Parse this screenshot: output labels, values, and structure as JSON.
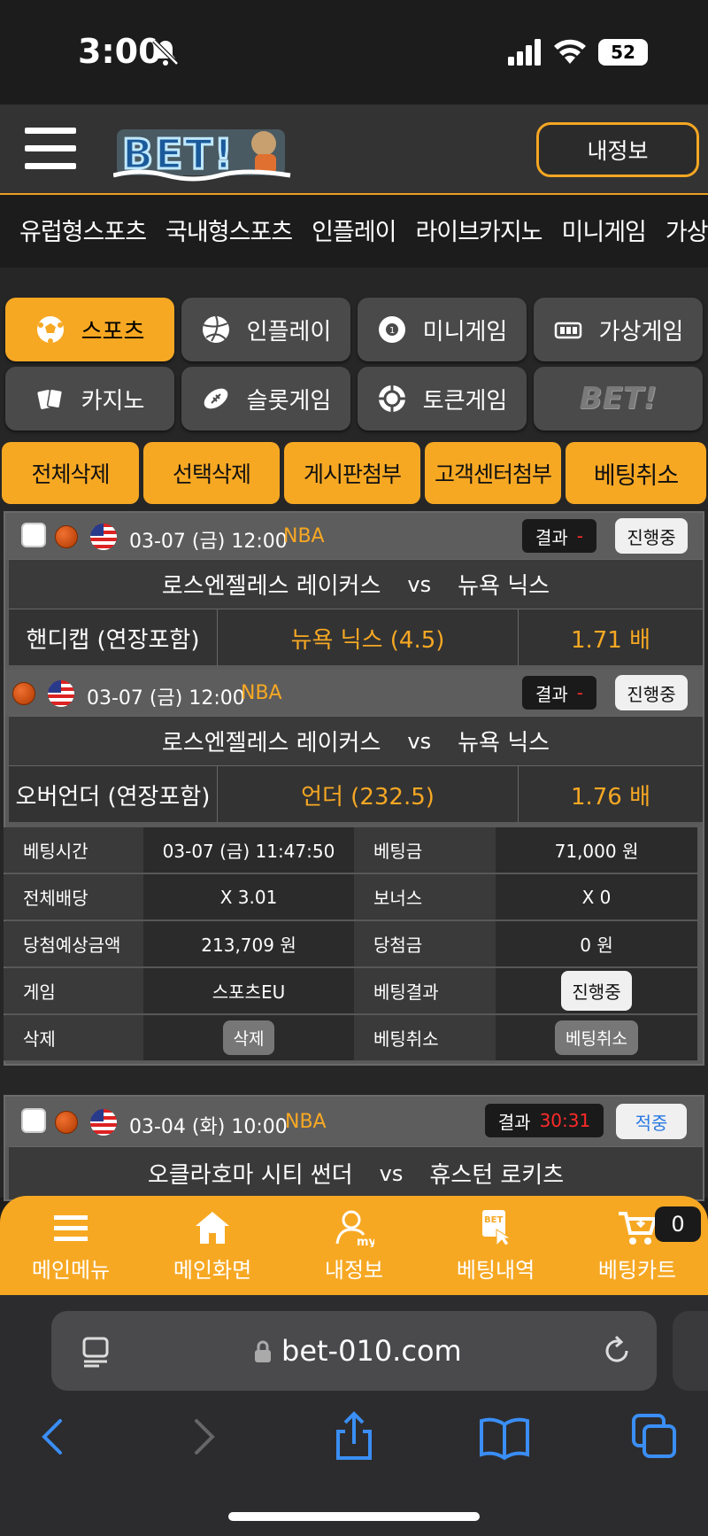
{
  "status_bar": {
    "time": "3:00",
    "battery": "52"
  },
  "header": {
    "myinfo_label": "내정보"
  },
  "top_nav": [
    "유럽형스포츠",
    "국내형스포츠",
    "인플레이",
    "라이브카지노",
    "미니게임",
    "가상게임"
  ],
  "categories": [
    {
      "label": "스포츠",
      "icon": "soccer-ball-icon",
      "active": true
    },
    {
      "label": "인플레이",
      "icon": "volleyball-icon",
      "active": false
    },
    {
      "label": "미니게임",
      "icon": "minigame-ball-icon",
      "active": false
    },
    {
      "label": "가상게임",
      "icon": "virtual-game-icon",
      "active": false
    },
    {
      "label": "카지노",
      "icon": "cards-icon",
      "active": false
    },
    {
      "label": "슬롯게임",
      "icon": "football-icon",
      "active": false
    },
    {
      "label": "토큰게임",
      "icon": "token-chip-icon",
      "active": false
    },
    {
      "label": "BET!",
      "icon": "bet-logo-icon",
      "active": false
    }
  ],
  "actions": [
    "전체삭제",
    "선택삭제",
    "게시판첨부",
    "고객센터첨부",
    "베팅취소"
  ],
  "bets": [
    {
      "date": "03-07 (금) 12:00",
      "league": "NBA",
      "result_label": "결과",
      "result_value": "-",
      "status": "진행중",
      "home": "로스엔젤레스 레이커스",
      "vs": "vs",
      "away": "뉴욕 닉스",
      "market": "핸디캡 (연장포함)",
      "pick": "뉴욕 닉스 (4.5)",
      "odds": "1.71 배"
    },
    {
      "date": "03-07 (금) 12:00",
      "league": "NBA",
      "result_label": "결과",
      "result_value": "-",
      "status": "진행중",
      "home": "로스엔젤레스 레이커스",
      "vs": "vs",
      "away": "뉴욕 닉스",
      "market": "오버언더 (연장포함)",
      "pick": "언더 (232.5)",
      "odds": "1.76 배"
    },
    {
      "date": "03-04 (화) 10:00",
      "league": "NBA",
      "result_label": "결과",
      "result_value": "30:31",
      "status": "적중",
      "home": "오클라호마 시티 썬더",
      "vs": "vs",
      "away": "휴스턴 로키츠"
    }
  ],
  "details": {
    "bet_time_label": "베팅시간",
    "bet_time": "03-07 (금) 11:47:50",
    "bet_amount_label": "베팅금",
    "bet_amount": "71,000 원",
    "total_odds_label": "전체배당",
    "total_odds": "X 3.01",
    "bonus_label": "보너스",
    "bonus": "X 0",
    "expected_label": "당첨예상금액",
    "expected": "213,709 원",
    "win_label": "당첨금",
    "win": "0 원",
    "game_label": "게임",
    "game": "스포츠EU",
    "result_label": "베팅결과",
    "result": "진행중",
    "delete_label": "삭제",
    "delete_btn": "삭제",
    "cancel_label": "베팅취소",
    "cancel_btn": "베팅취소"
  },
  "bottom_nav": [
    "메인메뉴",
    "메인화면",
    "내정보",
    "베팅내역",
    "베팅카트"
  ],
  "cart_count": "0",
  "browser": {
    "url": "bet-010.com"
  },
  "colors": {
    "accent": "#f7a823",
    "background": "#262626",
    "red": "#ff2a2a"
  }
}
